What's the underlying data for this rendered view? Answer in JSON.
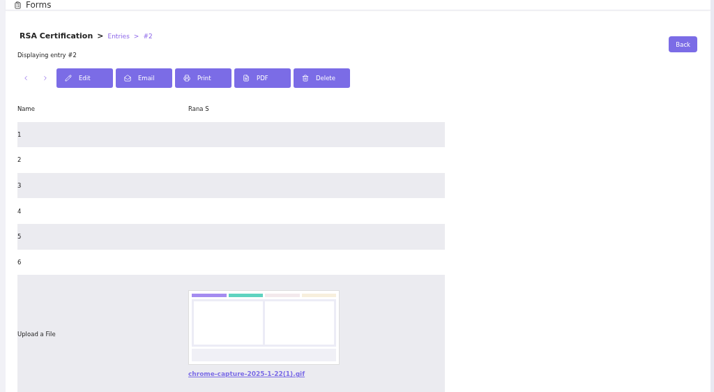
{
  "header": {
    "title": "Forms"
  },
  "breadcrumb": {
    "form": "RSA Certification",
    "separator": ">",
    "items": [
      "Entries",
      ">",
      "#2"
    ]
  },
  "subtitle": "Displaying entry #2",
  "back_button": "Back",
  "toolbar": [
    {
      "kind": "edit",
      "label": "Edit"
    },
    {
      "kind": "email",
      "label": "Email"
    },
    {
      "kind": "print",
      "label": "Print"
    },
    {
      "kind": "pdf",
      "label": "PDF"
    },
    {
      "kind": "delete",
      "label": "Delete"
    }
  ],
  "rows": [
    {
      "kind": "text",
      "label": "Name",
      "value": "Rana S"
    },
    {
      "kind": "text",
      "label": "1"
    },
    {
      "kind": "text",
      "label": "2"
    },
    {
      "kind": "text",
      "label": "3"
    },
    {
      "kind": "text",
      "label": "4"
    },
    {
      "kind": "text",
      "label": "5"
    },
    {
      "kind": "text",
      "label": "6"
    },
    {
      "kind": "file",
      "label": "Upload a File",
      "file_name": "chrome-capture-2025-1-22(1).gif"
    }
  ]
}
